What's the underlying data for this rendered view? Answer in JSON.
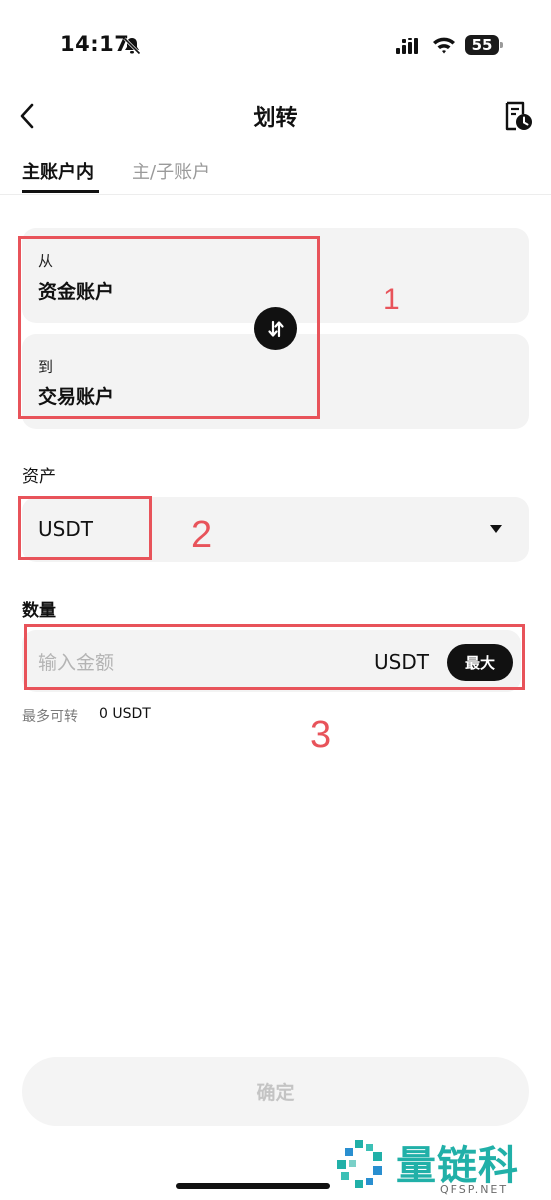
{
  "status_bar": {
    "time": "14:17",
    "battery": "55"
  },
  "header": {
    "title": "划转"
  },
  "tabs": [
    {
      "label": "主账户内",
      "active": true
    },
    {
      "label": "主/子账户",
      "active": false
    }
  ],
  "transfer": {
    "from_label": "从",
    "from_value": "资金账户",
    "to_label": "到",
    "to_value": "交易账户"
  },
  "asset": {
    "label": "资产",
    "value": "USDT"
  },
  "amount": {
    "label": "数量",
    "placeholder": "输入金额",
    "unit": "USDT",
    "max_label": "最大",
    "available_label": "最多可转",
    "available_value": "0 USDT"
  },
  "annotations": {
    "one": "1",
    "two": "2",
    "three": "3"
  },
  "confirm_label": "确定",
  "watermark": {
    "text": "量链科技",
    "sub": "QFSP.NET"
  },
  "colors": {
    "accent": "#111111",
    "annotation": "#e8535a",
    "card": "#f3f3f3",
    "watermark": "#21b0a8"
  }
}
